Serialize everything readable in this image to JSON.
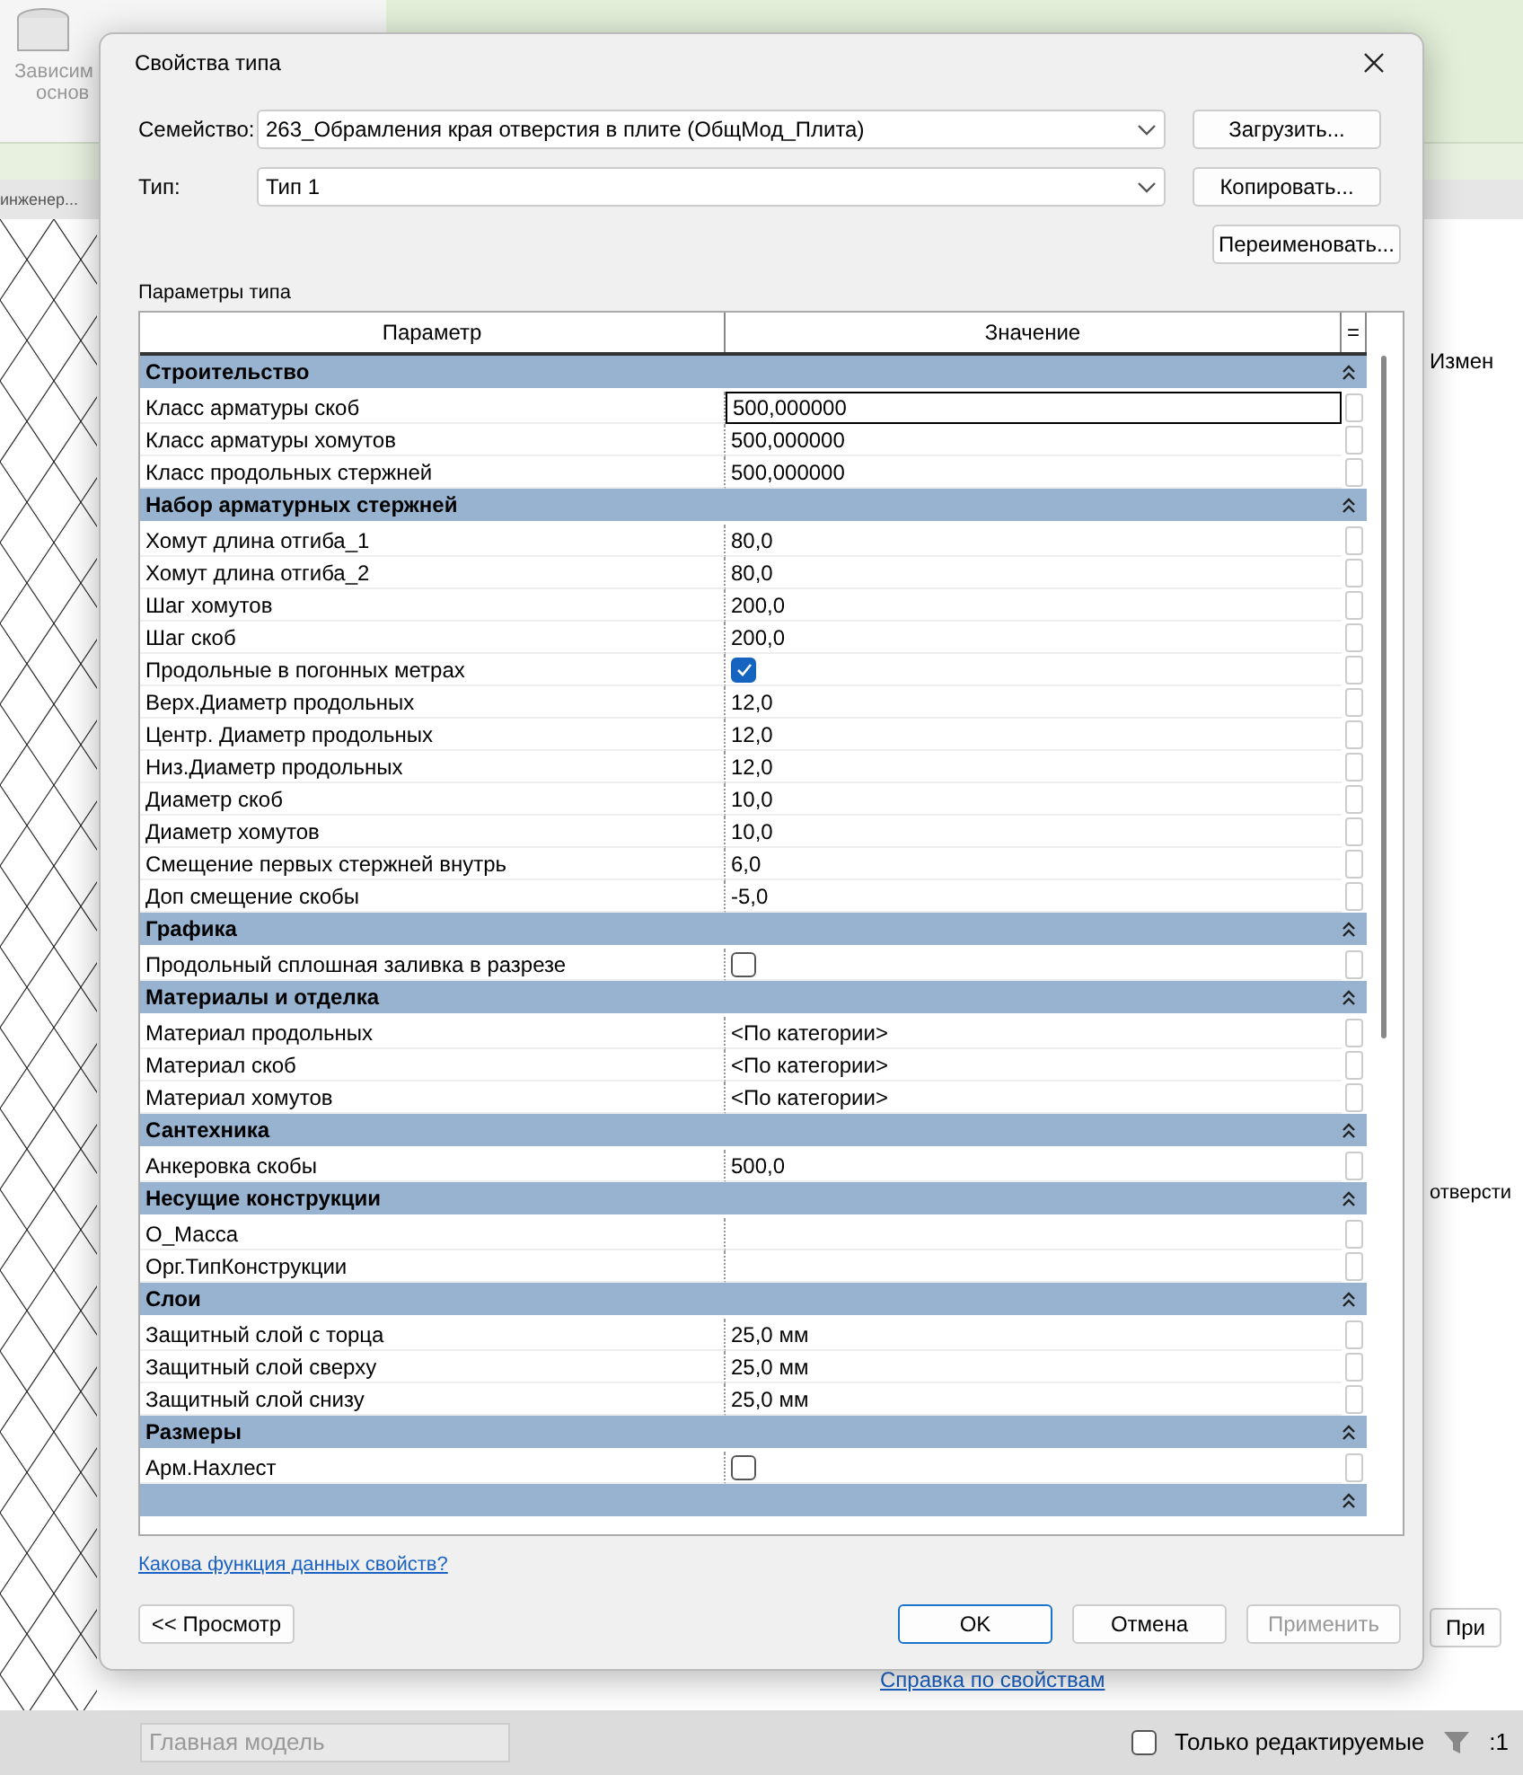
{
  "app": {
    "ribbon_label": [
      "Зависим",
      "основ"
    ],
    "view_tab": "инженер...",
    "side_panel": {
      "edit_label": "Измен",
      "row_text": "отверсти",
      "help_link": "Справка по свойствам",
      "apply_button": "При"
    },
    "status_bar": {
      "workset": "Главная модель",
      "editable_only": {
        "label": "Только редактируемые",
        "checked": false
      },
      "filter_count": ":1"
    }
  },
  "dialog": {
    "title": "Свойства типа",
    "fields": [
      {
        "label": "Семейство:",
        "value": "263_Обрамления края отверстия в плите (ОбщМод_Плита)"
      },
      {
        "label": "Тип:",
        "value": "Тип 1"
      }
    ],
    "side_buttons": [
      "Загрузить...",
      "Копировать...",
      "Переименовать..."
    ],
    "table_title": "Параметры типа",
    "columns": [
      "Параметр",
      "Значение",
      "="
    ],
    "groups": [
      {
        "title": "Строительство",
        "expanded": true,
        "rows": [
          {
            "name": "Класс арматуры скоб",
            "kind": "text",
            "value": "500,000000",
            "selected": true
          },
          {
            "name": "Класс арматуры хомутов",
            "kind": "text",
            "value": "500,000000",
            "selected": false
          },
          {
            "name": "Класс продольных стержней",
            "kind": "text",
            "value": "500,000000",
            "selected": false
          }
        ]
      },
      {
        "title": "Набор арматурных стержней",
        "expanded": true,
        "rows": [
          {
            "name": "Хомут длина отгиба_1",
            "kind": "text",
            "value": "80,0",
            "selected": false
          },
          {
            "name": "Хомут длина отгиба_2",
            "kind": "text",
            "value": "80,0",
            "selected": false
          },
          {
            "name": "Шаг хомутов",
            "kind": "text",
            "value": "200,0",
            "selected": false
          },
          {
            "name": "Шаг скоб",
            "kind": "text",
            "value": "200,0",
            "selected": false
          },
          {
            "name": "Продольные в погонных метрах",
            "kind": "checkbox",
            "checked": true,
            "selected": false
          },
          {
            "name": "Верх.Диаметр продольных",
            "kind": "text",
            "value": "12,0",
            "selected": false
          },
          {
            "name": "Центр. Диаметр продольных",
            "kind": "text",
            "value": "12,0",
            "selected": false
          },
          {
            "name": "Низ.Диаметр продольных",
            "kind": "text",
            "value": "12,0",
            "selected": false
          },
          {
            "name": "Диаметр скоб",
            "kind": "text",
            "value": "10,0",
            "selected": false
          },
          {
            "name": "Диаметр хомутов",
            "kind": "text",
            "value": "10,0",
            "selected": false
          },
          {
            "name": "Смещение первых стержней внутрь",
            "kind": "text",
            "value": "6,0",
            "selected": false
          },
          {
            "name": "Доп смещение скобы",
            "kind": "text",
            "value": "-5,0",
            "selected": false
          }
        ]
      },
      {
        "title": "Графика",
        "expanded": true,
        "rows": [
          {
            "name": "Продольный сплошная заливка в разрезе",
            "kind": "checkbox",
            "checked": false,
            "selected": false
          }
        ]
      },
      {
        "title": "Материалы и отделка",
        "expanded": true,
        "rows": [
          {
            "name": "Материал продольных",
            "kind": "text",
            "value": "<По категории>",
            "selected": false
          },
          {
            "name": "Материал скоб",
            "kind": "text",
            "value": "<По категории>",
            "selected": false
          },
          {
            "name": "Материал хомутов",
            "kind": "text",
            "value": "<По категории>",
            "selected": false
          }
        ]
      },
      {
        "title": "Сантехника",
        "expanded": true,
        "rows": [
          {
            "name": "Анкеровка скобы",
            "kind": "text",
            "value": "500,0",
            "selected": false
          }
        ]
      },
      {
        "title": "Несущие конструкции",
        "expanded": true,
        "rows": [
          {
            "name": "О_Масса",
            "kind": "text",
            "selected": false
          },
          {
            "name": "Орг.ТипКонструкции",
            "kind": "text",
            "selected": false
          }
        ]
      },
      {
        "title": "Слои",
        "expanded": true,
        "rows": [
          {
            "name": "Защитный слой с торца",
            "kind": "text",
            "value": "25,0 мм",
            "selected": false
          },
          {
            "name": "Защитный слой сверху",
            "kind": "text",
            "value": "25,0 мм",
            "selected": false
          },
          {
            "name": "Защитный слой снизу",
            "kind": "text",
            "value": "25,0 мм",
            "selected": false
          }
        ]
      },
      {
        "title": "Размеры",
        "expanded": true,
        "rows": [
          {
            "name": "Арм.Нахлест",
            "kind": "checkbox",
            "checked": false,
            "selected": false
          }
        ]
      },
      {
        "expanded": true
      }
    ],
    "help_link": "Какова функция данных свойств?",
    "preview_button": "<< Просмотр",
    "buttons": [
      {
        "label": "OK",
        "kind": "default",
        "disabled": false
      },
      {
        "label": "Отмена",
        "kind": "normal",
        "disabled": false
      },
      {
        "label": "Применить",
        "kind": "normal",
        "disabled": true
      }
    ]
  }
}
